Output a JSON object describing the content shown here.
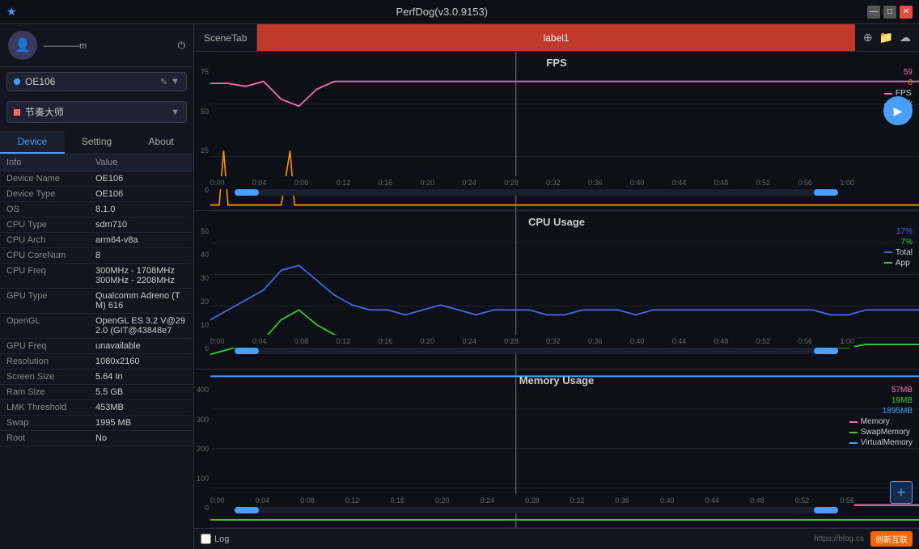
{
  "titleBar": {
    "title": "PerfDog(v3.0.9153)",
    "icon": "★",
    "minBtn": "—",
    "maxBtn": "□",
    "closeBtn": "✕"
  },
  "leftPanel": {
    "user": {
      "name": "————m",
      "powerIcon": "⏻"
    },
    "deviceSelector": {
      "label": "OE106",
      "editIcon": "✎",
      "dropIcon": "▼"
    },
    "appSelector": {
      "label": "节奏大师",
      "dropIcon": "▼"
    },
    "tabs": [
      {
        "id": "device",
        "label": "Device",
        "active": true
      },
      {
        "id": "setting",
        "label": "Setting",
        "active": false
      },
      {
        "id": "about",
        "label": "About",
        "active": false
      }
    ],
    "tableHeaders": {
      "info": "Info",
      "value": "Value"
    },
    "infoRows": [
      {
        "label": "Device Name",
        "value": "OE106"
      },
      {
        "label": "Device Type",
        "value": "OE106"
      },
      {
        "label": "OS",
        "value": "8.1.0"
      },
      {
        "label": "CPU Type",
        "value": "sdm710"
      },
      {
        "label": "CPU Arch",
        "value": "arm64-v8a"
      },
      {
        "label": "CPU CoreNum",
        "value": "8"
      },
      {
        "label": "CPU Freq",
        "value": "300MHz - 1708MHz\n300MHz - 2208MHz"
      },
      {
        "label": "GPU Type",
        "value": "Qualcomm Adreno (TM) 616"
      },
      {
        "label": "OpenGL",
        "value": "OpenGL ES 3.2 V@292.0 (GIT@43848e7"
      },
      {
        "label": "GPU Freq",
        "value": "unavailable"
      },
      {
        "label": "Resolution",
        "value": "1080x2160"
      },
      {
        "label": "Screen Size",
        "value": "5.64 In"
      },
      {
        "label": "Ram Size",
        "value": "5.5 GB"
      },
      {
        "label": "LMK Threshold",
        "value": "453MB"
      },
      {
        "label": "Swap",
        "value": "1995 MB"
      },
      {
        "label": "Root",
        "value": "No"
      }
    ]
  },
  "rightPanel": {
    "sceneTab": "SceneTab",
    "activeLabel": "label1",
    "rightIcons": [
      "⊕",
      "📁",
      "☁"
    ],
    "charts": {
      "fps": {
        "title": "FPS",
        "yLabel": "FPS",
        "yTicks": [
          "75",
          "50",
          "25",
          "0"
        ],
        "values": {
          "fps": 59,
          "jank": 0
        },
        "legendItems": [
          {
            "label": "FPS",
            "color": "#ff69b4"
          },
          {
            "label": "Jank",
            "color": "#ff8c00"
          }
        ]
      },
      "cpu": {
        "title": "CPU Usage",
        "yLabel": "%",
        "yTicks": [
          "50",
          "40",
          "30",
          "20",
          "10",
          "0"
        ],
        "values": {
          "total": "17%",
          "app": "7%"
        },
        "legendItems": [
          {
            "label": "Total",
            "color": "#4169e1"
          },
          {
            "label": "App",
            "color": "#32cd32"
          }
        ]
      },
      "memory": {
        "title": "Memory Usage",
        "yLabel": "MB",
        "yTicks": [
          "400",
          "300",
          "200",
          "100",
          "0"
        ],
        "values": {
          "memory": "57MB",
          "swapMemory": "19MB",
          "virtualMemory": "1895MB"
        },
        "legendItems": [
          {
            "label": "Memory",
            "color": "#ff69b4"
          },
          {
            "label": "SwapMemory",
            "color": "#32cd32"
          },
          {
            "label": "VirtualMemory",
            "color": "#4169e1"
          }
        ]
      }
    },
    "timeAxis": [
      "0:00",
      "0:04",
      "0:08",
      "0:12",
      "0:16",
      "0:20",
      "0:24",
      "0:28",
      "0:32",
      "0:36",
      "0:40",
      "0:44",
      "0:48",
      "0:52",
      "0:56",
      "1:00"
    ],
    "bottomBar": {
      "logCheckbox": "Log",
      "url": "https://blog.cs",
      "logo": "创新互联"
    }
  },
  "colors": {
    "fps": "#ff69b4",
    "jank": "#ff8c00",
    "cpuTotal": "#4169e1",
    "cpuApp": "#32cd32",
    "memory": "#ff69b4",
    "swapMemory": "#32cd32",
    "virtualMemory": "#4a9eff",
    "accent": "#4a9eff",
    "danger": "#c0392b"
  }
}
